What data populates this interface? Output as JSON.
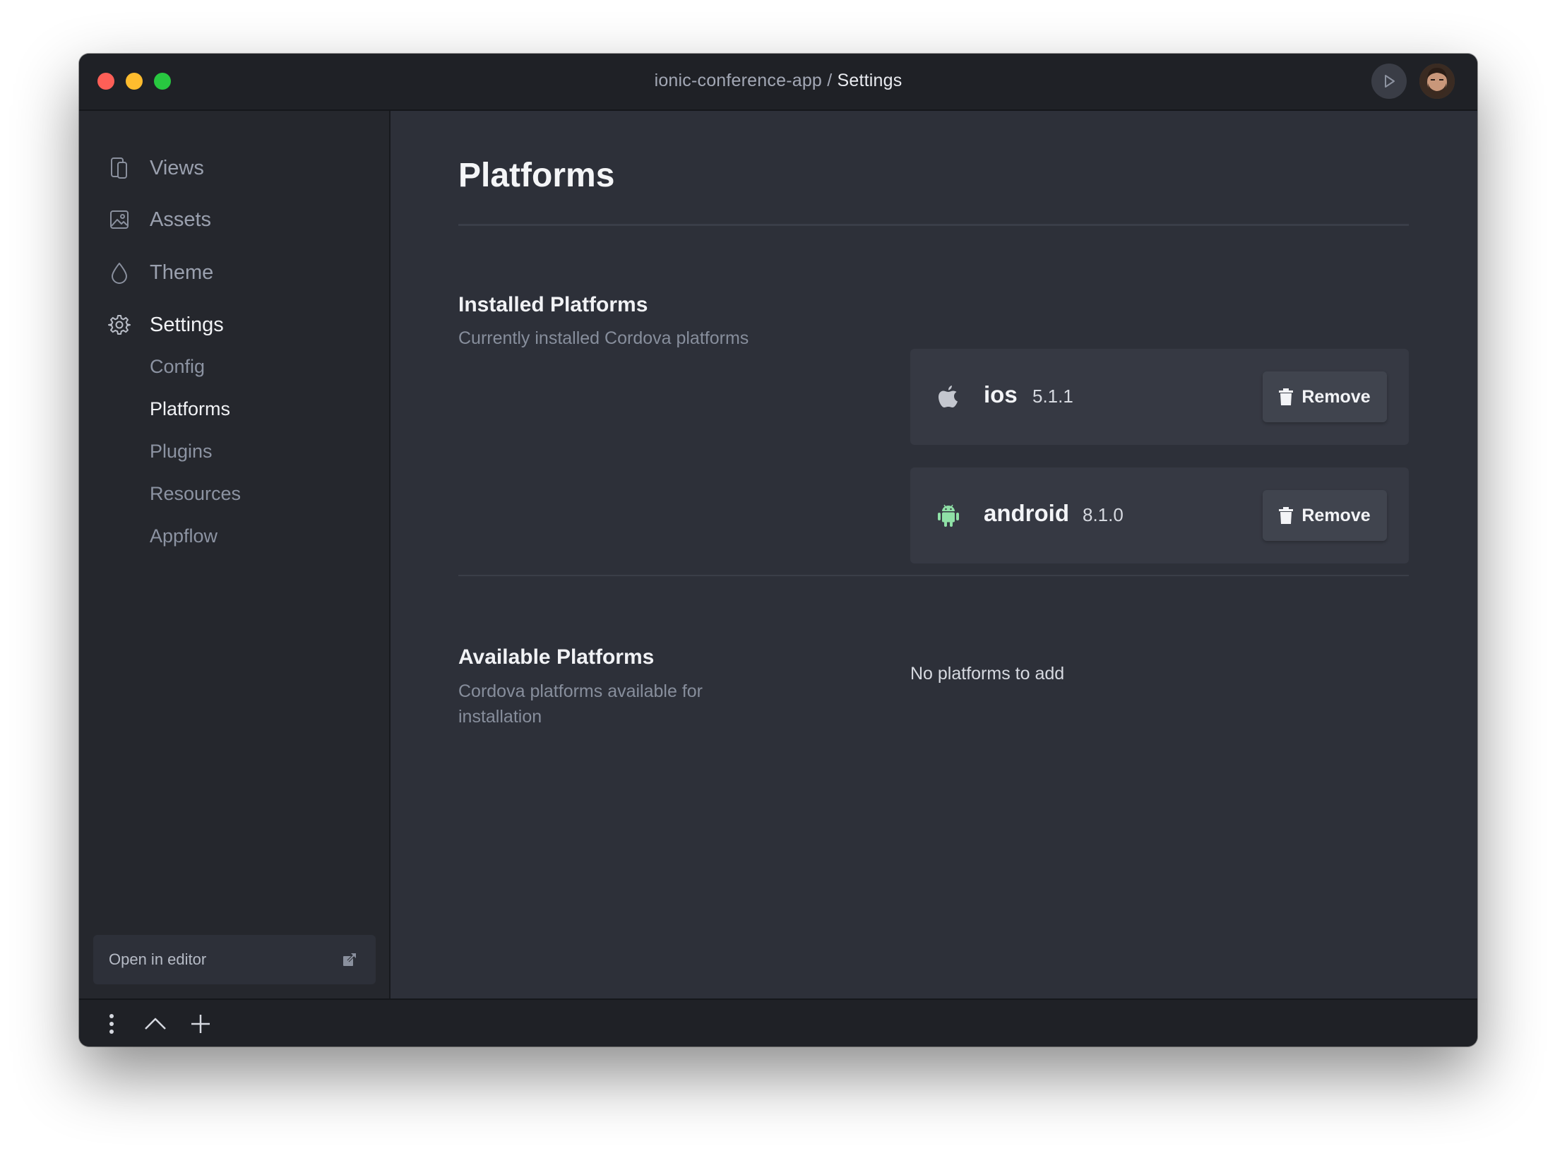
{
  "window": {
    "breadcrumb_project": "ionic-conference-app",
    "breadcrumb_separator": " / ",
    "breadcrumb_current": "Settings"
  },
  "sidebar": {
    "items": [
      {
        "label": "Views",
        "icon": "device-icon"
      },
      {
        "label": "Assets",
        "icon": "image-icon"
      },
      {
        "label": "Theme",
        "icon": "droplet-icon"
      },
      {
        "label": "Settings",
        "icon": "gear-icon",
        "active": true
      }
    ],
    "subitems": [
      {
        "label": "Config"
      },
      {
        "label": "Platforms",
        "active": true
      },
      {
        "label": "Plugins"
      },
      {
        "label": "Resources"
      },
      {
        "label": "Appflow"
      }
    ],
    "open_editor_label": "Open in editor"
  },
  "main": {
    "title": "Platforms",
    "installed": {
      "title": "Installed Platforms",
      "description": "Currently installed Cordova platforms",
      "platforms": [
        {
          "name": "ios",
          "version": "5.1.1",
          "icon": "apple-icon",
          "remove_label": "Remove"
        },
        {
          "name": "android",
          "version": "8.1.0",
          "icon": "android-icon",
          "icon_color": "#8fe0a6",
          "remove_label": "Remove"
        }
      ]
    },
    "available": {
      "title": "Available Platforms",
      "description": "Cordova platforms available for installation",
      "empty_text": "No platforms to add"
    }
  },
  "colors": {
    "traffic_red": "#fe5f57",
    "traffic_yellow": "#febc2e",
    "traffic_green": "#28c840",
    "android_green": "#8fe0a6"
  }
}
